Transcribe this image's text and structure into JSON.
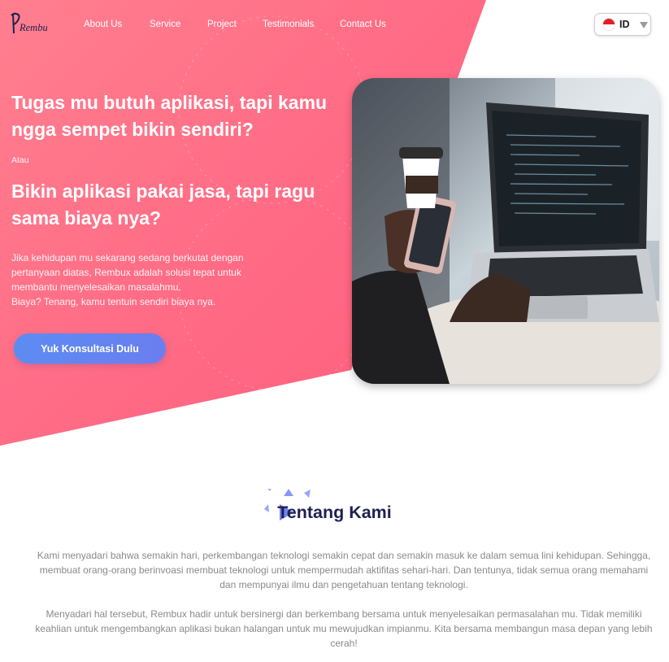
{
  "brand": {
    "logo_text": "Rembux"
  },
  "nav": {
    "items": [
      {
        "label": "About Us"
      },
      {
        "label": "Service"
      },
      {
        "label": "Project"
      },
      {
        "label": "Testimonials"
      },
      {
        "label": "Contact Us"
      }
    ]
  },
  "language": {
    "code": "ID",
    "flag_icon": "indonesia-flag-icon"
  },
  "hero": {
    "headline": "Tugas mu butuh aplikasi, tapi kamu ngga sempet bikin sendiri?",
    "or_text": "Atau",
    "headline2": "Bikin aplikasi pakai jasa, tapi ragu sama biaya nya?",
    "description": [
      "Jika kehidupan mu sekarang sedang berkutat dengan pertanyaan diatas, Rembux adalah solusi tepat untuk membantu menyelesaikan masalahmu.",
      "Biaya? Tenang, kamu tentuin sendiri biaya nya."
    ],
    "cta_label": "Yuk Konsultasi Dulu",
    "image_icon": "laptop-photo"
  },
  "about": {
    "title": "Tentang Kami",
    "paragraphs": [
      "Kami menyadari bahwa semakin hari, perkembangan teknologi semakin cepat dan semakin masuk ke dalam semua lini kehidupan. Sehingga, membuat orang-orang berinvoasi membuat teknologi untuk mempermudah aktifitas sehari-hari. Dan tentunya, tidak semua orang memahami dan mempunyai ilmu dan pengetahuan tentang teknologi.",
      "Menyadari hal tersebut, Rembux hadir untuk bersinergi dan berkembang bersama untuk menyelesaikan permasalahan mu. Tidak memiliki keahlian untuk mengembangkan aplikasi bukan halangan untuk mu mewujudkan impianmu. Kita bersama membangun masa depan yang lebih cerah!"
    ]
  },
  "colors": {
    "hero_gradient_start": "#ff7f8f",
    "hero_gradient_end": "#ff5a79",
    "cta_gradient_start": "#5c8cf2",
    "cta_gradient_end": "#6a7ef0",
    "title_color": "#1d2150",
    "body_text": "#8a8a8a"
  }
}
